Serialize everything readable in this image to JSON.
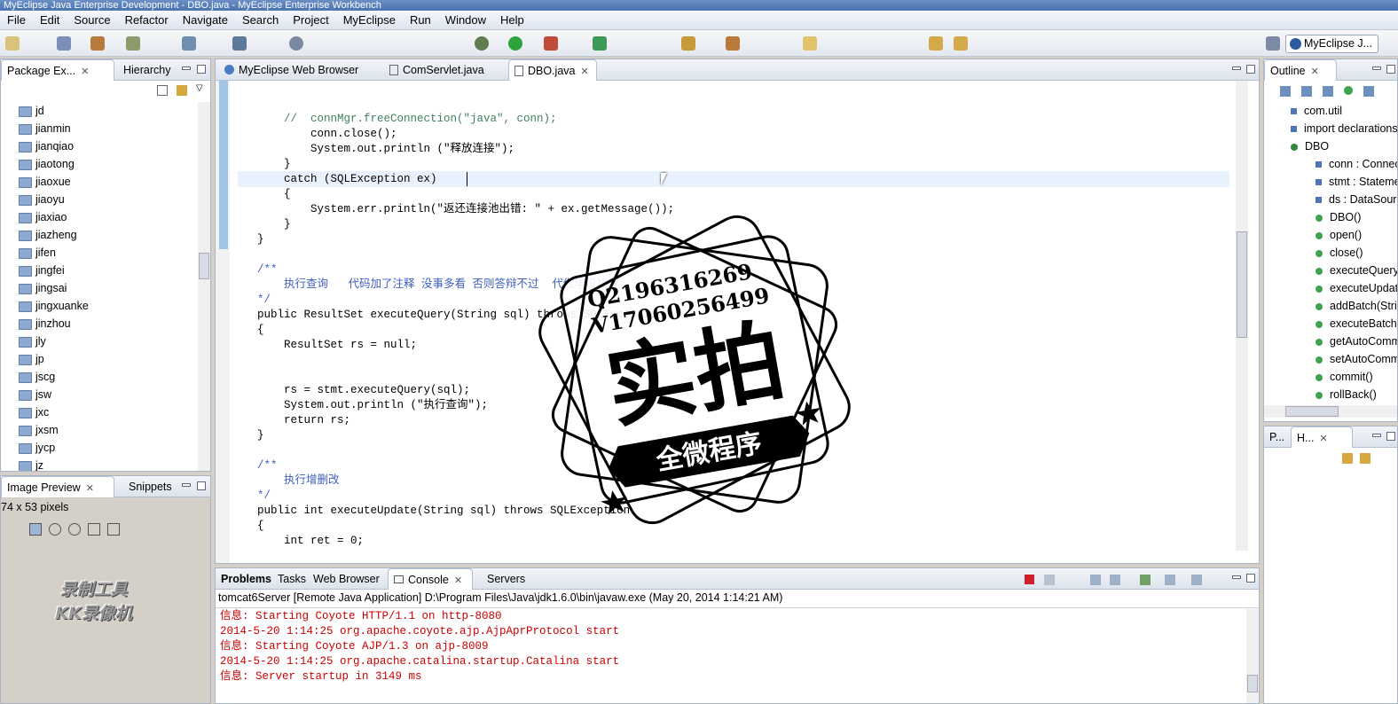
{
  "window": {
    "title": "MyEclipse Java Enterprise Development - DBO.java - MyEclipse Enterprise Workbench"
  },
  "menu": [
    "File",
    "Edit",
    "Source",
    "Refactor",
    "Navigate",
    "Search",
    "Project",
    "MyEclipse",
    "Run",
    "Window",
    "Help"
  ],
  "perspective": {
    "label": "MyEclipse J..."
  },
  "package_explorer": {
    "tabs": [
      "Package Ex...",
      "Hierarchy"
    ],
    "items": [
      "jd",
      "jianmin",
      "jianqiao",
      "jiaotong",
      "jiaoxue",
      "jiaoyu",
      "jiaxiao",
      "jiazheng",
      "jifen",
      "jingfei",
      "jingsai",
      "jingxuanke",
      "jinzhou",
      "jly",
      "jp",
      "jscg",
      "jsw",
      "jxc",
      "jxsm",
      "jycp",
      "jz"
    ]
  },
  "image_preview": {
    "tabs": [
      "Image Preview",
      "Snippets"
    ],
    "info": "74 x 53 pixels"
  },
  "editor": {
    "tabs": [
      "MyEclipse Web Browser",
      "ComServlet.java",
      "DBO.java"
    ],
    "lines": [
      {
        "t": "        //  connMgr.freeConnection(\"java\", conn);",
        "c": "cm"
      },
      {
        "t": "            conn.close();",
        "c": ""
      },
      {
        "t": "            System.out.println (\"释放连接\");",
        "c": ""
      },
      {
        "t": "        }",
        "c": ""
      },
      {
        "t": "        catch (SQLException ex) ",
        "c": ""
      },
      {
        "t": "        {",
        "c": ""
      },
      {
        "t": "            System.err.println(\"返还连接池出错: \" + ex.getMessage());",
        "c": ""
      },
      {
        "t": "        }",
        "c": ""
      },
      {
        "t": "    }",
        "c": ""
      },
      {
        "t": "",
        "c": ""
      },
      {
        "t": "    /**",
        "c": "jd"
      },
      {
        "t": "        执行查询   代码加了注释 没事多看 否则答辩不过  代做毕设找我",
        "c": "jd"
      },
      {
        "t": "    */",
        "c": "jd"
      },
      {
        "t": "    public ResultSet executeQuery(String sql) throws SQLException",
        "c": ""
      },
      {
        "t": "    {",
        "c": ""
      },
      {
        "t": "        ResultSet rs = null;",
        "c": ""
      },
      {
        "t": "",
        "c": ""
      },
      {
        "t": "",
        "c": ""
      },
      {
        "t": "        rs = stmt.executeQuery(sql);",
        "c": ""
      },
      {
        "t": "        System.out.println (\"执行查询\");",
        "c": ""
      },
      {
        "t": "        return rs;",
        "c": ""
      },
      {
        "t": "    }",
        "c": ""
      },
      {
        "t": "",
        "c": ""
      },
      {
        "t": "    /**",
        "c": "jd"
      },
      {
        "t": "        执行增删改",
        "c": "jd"
      },
      {
        "t": "    */",
        "c": "jd"
      },
      {
        "t": "    public int executeUpdate(String sql) throws SQLException",
        "c": ""
      },
      {
        "t": "    {",
        "c": ""
      },
      {
        "t": "        int ret = 0;",
        "c": ""
      }
    ]
  },
  "outline": {
    "tab": "Outline",
    "items": [
      {
        "label": "com.util",
        "kind": "pkg",
        "indent": 0
      },
      {
        "label": "import declarations",
        "kind": "imp",
        "indent": 0
      },
      {
        "label": "DBO",
        "kind": "cls",
        "indent": 0
      },
      {
        "label": "conn : Connection",
        "kind": "field",
        "indent": 1
      },
      {
        "label": "stmt : Statement",
        "kind": "field",
        "indent": 1
      },
      {
        "label": "ds : DataSource",
        "kind": "field",
        "indent": 1
      },
      {
        "label": "DBO()",
        "kind": "method",
        "indent": 1
      },
      {
        "label": "open()",
        "kind": "method",
        "indent": 1
      },
      {
        "label": "close()",
        "kind": "method",
        "indent": 1
      },
      {
        "label": "executeQuery(String)",
        "kind": "method",
        "indent": 1
      },
      {
        "label": "executeUpdate(String)",
        "kind": "method",
        "indent": 1
      },
      {
        "label": "addBatch(String)",
        "kind": "method",
        "indent": 1
      },
      {
        "label": "executeBatch()",
        "kind": "method",
        "indent": 1
      },
      {
        "label": "getAutoCommit()",
        "kind": "method",
        "indent": 1
      },
      {
        "label": "setAutoCommit(boolean)",
        "kind": "method",
        "indent": 1
      },
      {
        "label": "commit()",
        "kind": "method",
        "indent": 1
      },
      {
        "label": "rollBack()",
        "kind": "method",
        "indent": 1
      }
    ]
  },
  "small_view": {
    "tabs": [
      "P...",
      "H..."
    ]
  },
  "console": {
    "tabs": [
      "Problems",
      "Tasks",
      "Web Browser",
      "Console",
      "Servers"
    ],
    "header": "tomcat6Server [Remote Java Application] D:\\Program Files\\Java\\jdk1.6.0\\bin\\javaw.exe (May 20, 2014 1:14:21 AM)",
    "lines": [
      "信息: Starting Coyote HTTP/1.1 on http-8080",
      "2014-5-20 1:14:25 org.apache.coyote.ajp.AjpAprProtocol start",
      "信息: Starting Coyote AJP/1.3 on ajp-8009",
      "2014-5-20 1:14:25 org.apache.catalina.startup.Catalina start",
      "信息: Server startup in 3149 ms"
    ]
  },
  "stamp": {
    "line1": "Q2196316269",
    "line2": "V17060256499",
    "main": "实拍",
    "banner": "全微程序"
  },
  "watermark": {
    "line1": "录制工具",
    "line2": "KK录像机"
  },
  "colors": {
    "keyword": "#7f0055",
    "string": "#2a00ff",
    "comment": "#3f7f5f",
    "javadoc": "#3f5fbf",
    "console_text": "#cc0000"
  }
}
